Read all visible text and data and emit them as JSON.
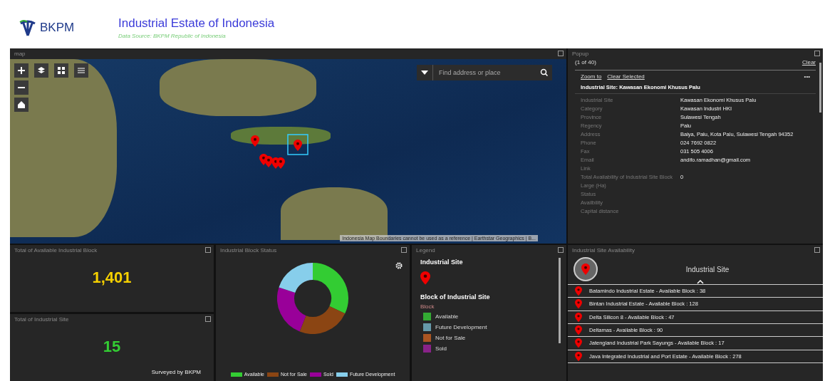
{
  "header": {
    "logo_text": "BKPM",
    "title": "Industrial Estate of Indonesia",
    "subtitle": "Data Source: BKPM Republic of Indonesia"
  },
  "map": {
    "title": "map",
    "search": {
      "placeholder": "Find address or place"
    },
    "attribution": "Indonesia Map Boundaries cannot be used as a reference | Earthstar Geographics | B..."
  },
  "popup": {
    "title": "Popup",
    "counter": "(1 of 40)",
    "clear": "Clear",
    "actions": [
      "Zoom to",
      "Clear Selected"
    ],
    "more": "•••",
    "heading": "Industrial Site: Kawasan Ekonomi Khusus Palu",
    "fields": [
      {
        "label": "Industrial Site",
        "value": "Kawasan Ekonomi Khusus Palu"
      },
      {
        "label": "Category",
        "value": "Kawasan Industri HKI"
      },
      {
        "label": "Province",
        "value": "Sulawesi Tengah"
      },
      {
        "label": "Regency",
        "value": "Palu"
      },
      {
        "label": "Address",
        "value": "Baiya, Palu, Kota Palu, Sulawesi Tengah 94352"
      },
      {
        "label": "Phone",
        "value": "024 7692 0822"
      },
      {
        "label": "Fax",
        "value": "031 505 4006"
      },
      {
        "label": "Email",
        "value": "andifo.ramadhan@gmail.com"
      },
      {
        "label": "Link"
      },
      {
        "label": "Total Availability of Industrial Site Block",
        "value": "0"
      },
      {
        "label": "Large (Ha)"
      },
      {
        "label": "Status"
      },
      {
        "label": "Availbility"
      },
      {
        "label": "Capital distance"
      }
    ]
  },
  "available_blocks": {
    "title": "Total of Available Industrial Block",
    "value": "1,401"
  },
  "industrial_sites": {
    "title": "Total of Industrial Site",
    "value": "15",
    "note": "Surveyed by BKPM"
  },
  "block_status": {
    "title": "Industrial Block Status",
    "legend": [
      {
        "label": "Available",
        "color": "#33cc33"
      },
      {
        "label": "Not for Sale",
        "color": "#8b4513"
      },
      {
        "label": "Sold",
        "color": "#990099"
      },
      {
        "label": "Future Development",
        "color": "#87ceeb"
      }
    ]
  },
  "legend": {
    "title": "Legend",
    "layer_1": "Industrial Site",
    "layer_2": "Block of Industrial Site",
    "field": "Block",
    "items": [
      {
        "label": "Available",
        "color": "#33aa33"
      },
      {
        "label": "Future Development",
        "color": "#6699aa"
      },
      {
        "label": "Not for Sale",
        "color": "#aa5522"
      },
      {
        "label": "Sold",
        "color": "#882288"
      }
    ]
  },
  "availability": {
    "title": "Industrial Site Availability",
    "heading": "Industrial Site",
    "sites": [
      "Batamindo Industrial Estate - Available Block : 38",
      "Bintan Industrial Estate - Available Block : 128",
      "Delta Silicon 8 - Available Block : 47",
      "Deltamas - Available Block : 90",
      "Jatengland Industrial Park Sayungs - Available Block : 17",
      "Java Integrated Industrial and Port Estate - Available Block : 278"
    ]
  }
}
